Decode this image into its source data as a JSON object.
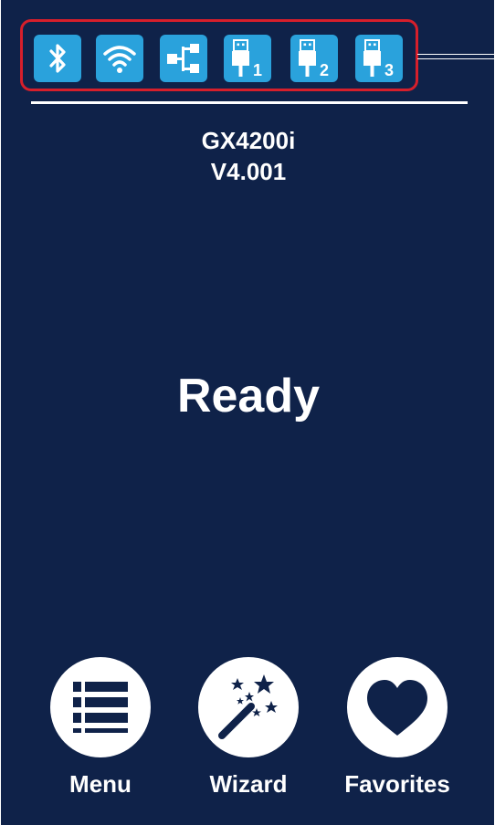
{
  "status_bar": {
    "icons": [
      {
        "name": "bluetooth-icon"
      },
      {
        "name": "wifi-icon"
      },
      {
        "name": "ethernet-icon"
      },
      {
        "name": "usb-port-icon",
        "number": "1"
      },
      {
        "name": "usb-port-icon",
        "number": "2"
      },
      {
        "name": "usb-port-icon",
        "number": "3"
      }
    ]
  },
  "printer": {
    "model": "GX4200i",
    "version": "V4.001"
  },
  "status": {
    "text": "Ready"
  },
  "nav": {
    "menu_label": "Menu",
    "wizard_label": "Wizard",
    "favorites_label": "Favorites"
  },
  "colors": {
    "background": "#0f2249",
    "icon_tile": "#2aa2dc",
    "highlight_frame": "#d61f2b",
    "foreground": "#ffffff"
  }
}
